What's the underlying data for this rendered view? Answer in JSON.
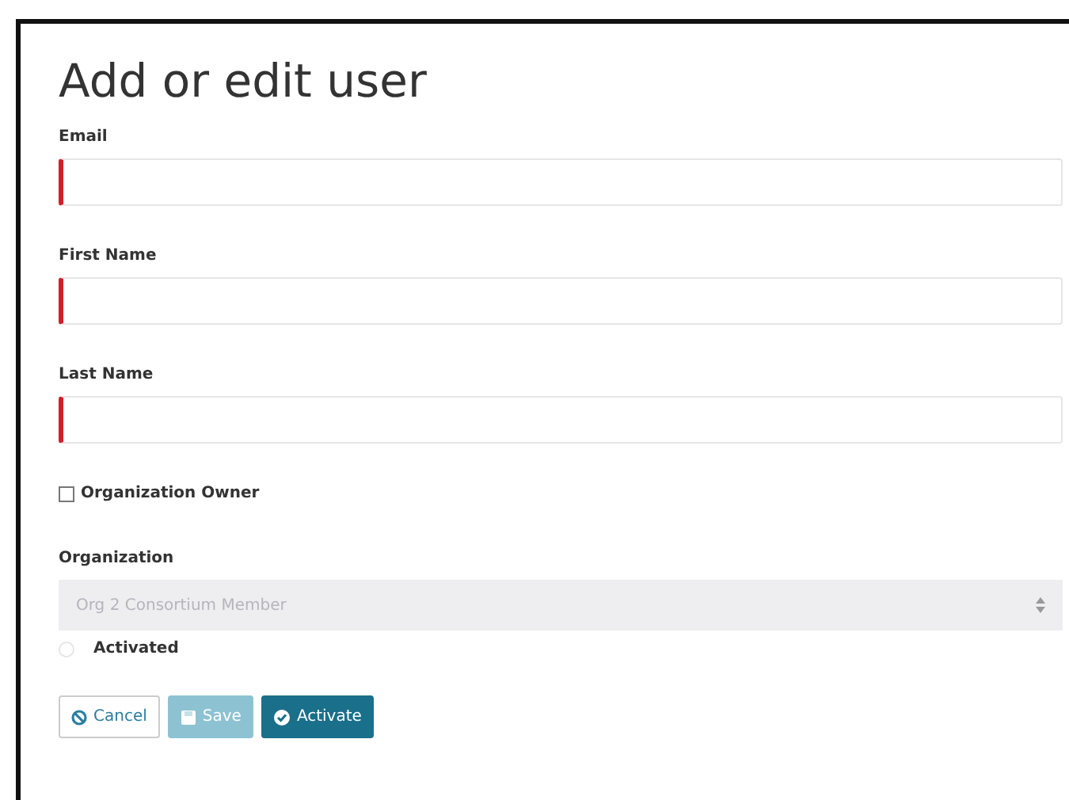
{
  "title": "Add or edit user",
  "fields": [
    {
      "label": "Email",
      "required": true
    },
    {
      "label": "First Name",
      "required": true
    },
    {
      "label": "Last Name",
      "required": true
    }
  ],
  "organization_owner": {
    "label": "Organization Owner",
    "checked": false
  },
  "organization": {
    "label": "Organization",
    "value": "Org 2 Consortium Member",
    "disabled": true
  },
  "activated": {
    "label": "Activated",
    "checked": false
  },
  "buttons": [
    {
      "label": "Cancel",
      "kind": "cancel",
      "disabled": false
    },
    {
      "label": "Save",
      "kind": "save",
      "disabled": true
    },
    {
      "label": "Activate",
      "kind": "activate",
      "disabled": false
    }
  ]
}
